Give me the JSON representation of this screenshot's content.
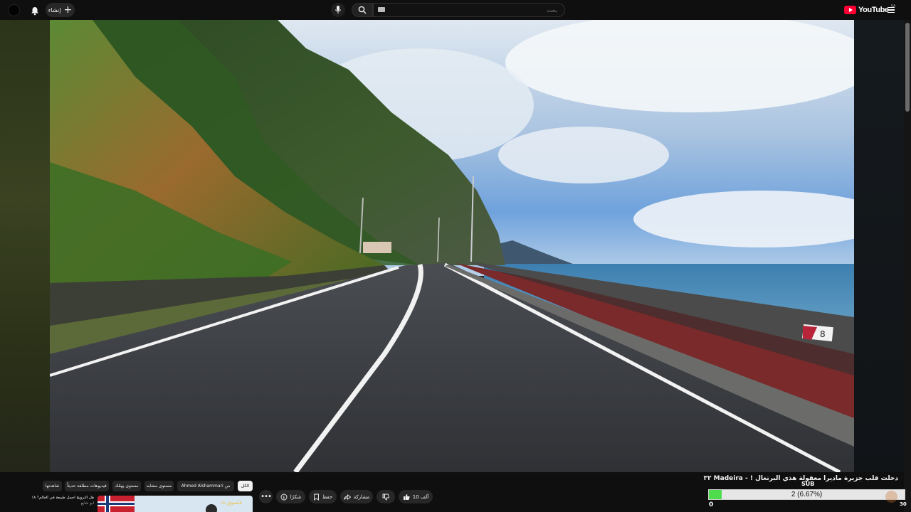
{
  "header": {
    "logo_text": "YouTube",
    "logo_country": "SA",
    "create_label": "إنشاء",
    "search_placeholder": "بحث",
    "icons": [
      "avatar",
      "bell-icon",
      "plus-icon",
      "mic-icon",
      "search-icon",
      "keyboard-icon",
      "youtube-logo",
      "menu-icon"
    ]
  },
  "video": {
    "title": "دخلت قلب جزيرة ماديرا معقولة هذي البرتغال ! - Madeira ٣٢",
    "scene": "coastal road along a cliff by the ocean",
    "sign_text": "8"
  },
  "actions": {
    "like_count": "10 آلف",
    "share_label": "مشاركة",
    "save_label": "حفظ",
    "thanks_label": "شكرًا",
    "more_label": "•••"
  },
  "chips": [
    {
      "label": "الكل",
      "active": true
    },
    {
      "label": "من Ahmed Alshammari",
      "active": false
    },
    {
      "label": "مستوى يهمّك",
      "active": false
    },
    {
      "label": "مستوى مشابه",
      "active": false
    },
    {
      "label": "فيديوهات مطلقة حديثاً",
      "active": false
    },
    {
      "label": "شاهدتها",
      "active": false
    }
  ],
  "recommendation": {
    "title": "هل النرويج أجمل طبيعة في العالم؟ ١٨",
    "channel": "ابو شايع",
    "thumb_caption": "فلسوق ١٨"
  },
  "progress_overlay": {
    "label": "SUB",
    "text": "2 (6.67%)",
    "fraction": 0.0667,
    "min": "0",
    "max": "30",
    "fill_color": "#4cdc4c"
  },
  "colors": {
    "background": "#0f0f0f",
    "pill": "#272727",
    "brand_red": "#ff0033"
  }
}
